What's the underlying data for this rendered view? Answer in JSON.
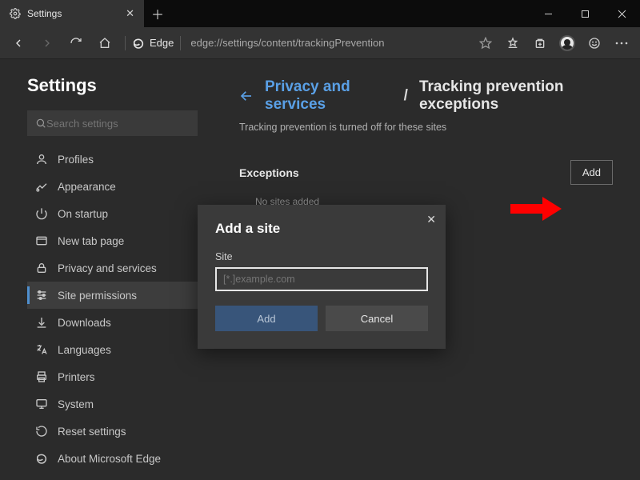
{
  "window": {
    "tab_title": "Settings",
    "addr_label": "Edge",
    "url": "edge://settings/content/trackingPrevention"
  },
  "sidebar": {
    "title": "Settings",
    "search_placeholder": "Search settings",
    "items": [
      {
        "icon": "profile-icon",
        "label": "Profiles"
      },
      {
        "icon": "appearance-icon",
        "label": "Appearance"
      },
      {
        "icon": "power-icon",
        "label": "On startup"
      },
      {
        "icon": "newtab-icon",
        "label": "New tab page"
      },
      {
        "icon": "lock-icon",
        "label": "Privacy and services"
      },
      {
        "icon": "permissions-icon",
        "label": "Site permissions"
      },
      {
        "icon": "download-icon",
        "label": "Downloads"
      },
      {
        "icon": "language-icon",
        "label": "Languages"
      },
      {
        "icon": "printer-icon",
        "label": "Printers"
      },
      {
        "icon": "system-icon",
        "label": "System"
      },
      {
        "icon": "reset-icon",
        "label": "Reset settings"
      },
      {
        "icon": "edge-icon",
        "label": "About Microsoft Edge"
      }
    ],
    "selected_index": 5
  },
  "main": {
    "breadcrumb_link": "Privacy and services",
    "breadcrumb_current": "Tracking prevention exceptions",
    "description": "Tracking prevention is turned off for these sites",
    "section_title": "Exceptions",
    "add_button": "Add",
    "empty_text": "No sites added"
  },
  "dialog": {
    "title": "Add a site",
    "field_label": "Site",
    "placeholder": "[*.]example.com",
    "value": "",
    "primary": "Add",
    "secondary": "Cancel"
  },
  "annotation": {
    "arrow_color": "#ff0000"
  }
}
